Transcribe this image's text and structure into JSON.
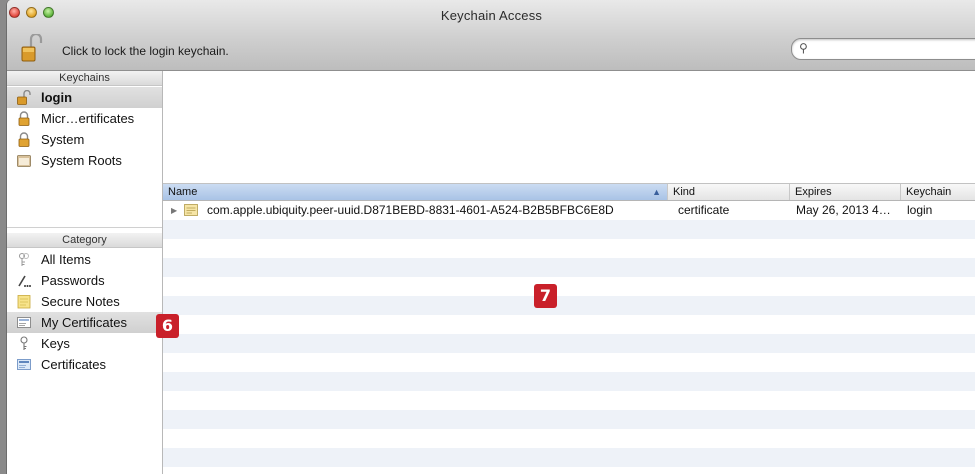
{
  "window": {
    "title": "Keychain Access"
  },
  "toolbar": {
    "lock_text": "Click to lock the login keychain.",
    "search_placeholder": ""
  },
  "keychains": {
    "header": "Keychains",
    "items": [
      {
        "label": "login",
        "icon": "unlocked-padlock-icon",
        "selected": true
      },
      {
        "label": "Micr…ertificates",
        "icon": "padlock-icon"
      },
      {
        "label": "System",
        "icon": "padlock-icon"
      },
      {
        "label": "System Roots",
        "icon": "folder-icon"
      }
    ]
  },
  "category": {
    "header": "Category",
    "items": [
      {
        "label": "All Items",
        "icon": "all-items-icon"
      },
      {
        "label": "Passwords",
        "icon": "passwords-icon"
      },
      {
        "label": "Secure Notes",
        "icon": "secure-notes-icon"
      },
      {
        "label": "My Certificates",
        "icon": "certificate-icon",
        "selected": true
      },
      {
        "label": "Keys",
        "icon": "key-icon"
      },
      {
        "label": "Certificates",
        "icon": "certificates-icon"
      }
    ]
  },
  "callouts": {
    "six": "6",
    "seven": "7",
    "color": "#c9202a"
  },
  "table": {
    "columns": [
      "Name",
      "Kind",
      "Expires",
      "Keychain"
    ],
    "sorted_column": "Name",
    "rows": [
      {
        "name": "com.apple.ubiquity.peer-uuid.D871BEBD-8831-4601-A524-B2B5BFBC6E8D",
        "kind": "certificate",
        "expires": "May 26, 2013 4…",
        "keychain": "login"
      }
    ]
  }
}
